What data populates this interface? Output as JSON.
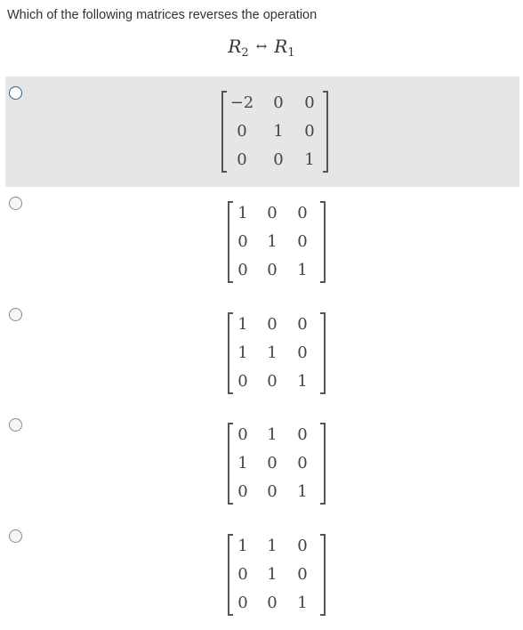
{
  "question": {
    "text": "Which of the following matrices reverses the operation",
    "operation": {
      "lhs": "R",
      "lhs_sub": "2",
      "arrow": "↔",
      "rhs": "R",
      "rhs_sub": "1"
    }
  },
  "options": [
    {
      "selected": false,
      "highlighted": true,
      "matrix": [
        [
          "−2",
          "0",
          "0"
        ],
        [
          "0",
          "1",
          "0"
        ],
        [
          "0",
          "0",
          "1"
        ]
      ]
    },
    {
      "selected": false,
      "highlighted": false,
      "matrix": [
        [
          "1",
          "0",
          "0"
        ],
        [
          "0",
          "1",
          "0"
        ],
        [
          "0",
          "0",
          "1"
        ]
      ]
    },
    {
      "selected": false,
      "highlighted": false,
      "matrix": [
        [
          "1",
          "0",
          "0"
        ],
        [
          "1",
          "1",
          "0"
        ],
        [
          "0",
          "0",
          "1"
        ]
      ]
    },
    {
      "selected": false,
      "highlighted": false,
      "matrix": [
        [
          "0",
          "1",
          "0"
        ],
        [
          "1",
          "0",
          "0"
        ],
        [
          "0",
          "0",
          "1"
        ]
      ]
    },
    {
      "selected": false,
      "highlighted": false,
      "matrix": [
        [
          "1",
          "1",
          "0"
        ],
        [
          "0",
          "1",
          "0"
        ],
        [
          "0",
          "0",
          "1"
        ]
      ]
    }
  ]
}
